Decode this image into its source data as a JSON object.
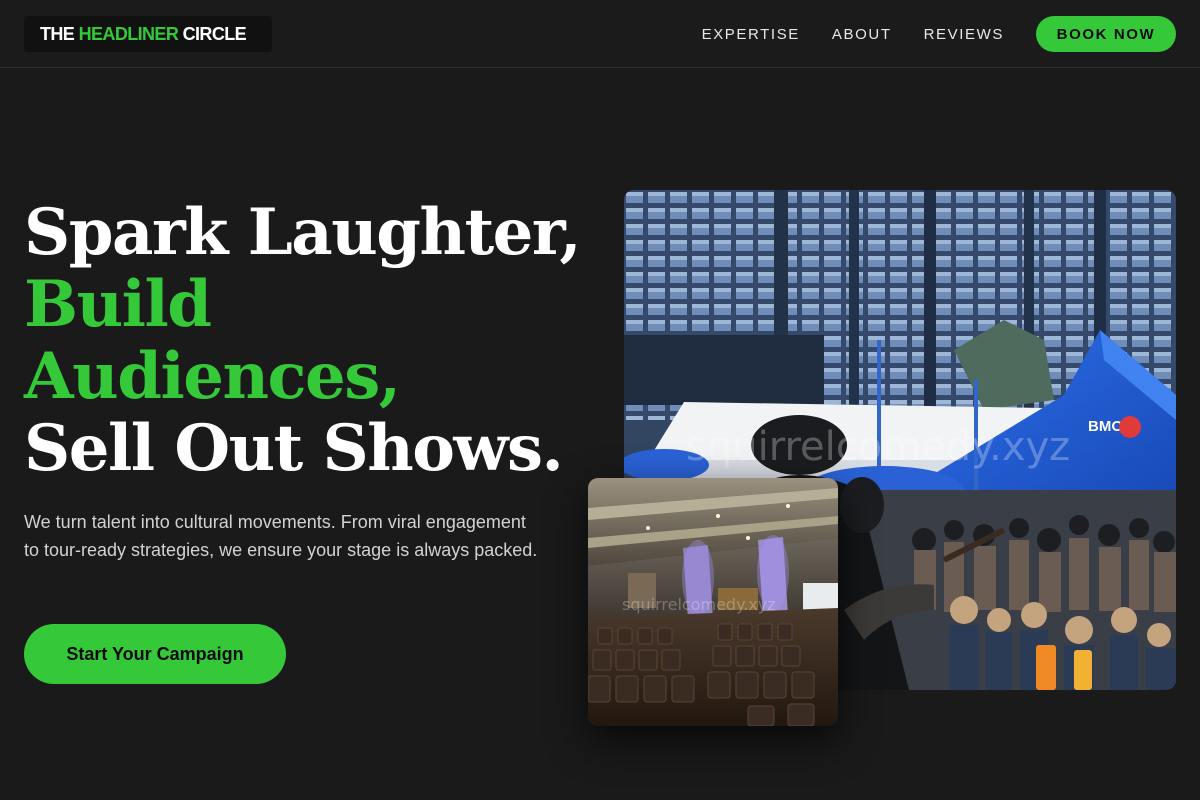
{
  "header": {
    "logo": {
      "prefix": "THE ",
      "accent": "HEADLINER",
      "suffix": " CIRCLE"
    },
    "nav": [
      {
        "label": "EXPERTISE"
      },
      {
        "label": "ABOUT"
      },
      {
        "label": "REVIEWS"
      }
    ],
    "book_label": "BOOK NOW"
  },
  "hero": {
    "title_lines": [
      "Spark Laughter,",
      "Build",
      "Audiences,",
      "Sell Out Shows."
    ],
    "description": "We turn talent into cultural movements. From viral engagement to tour-ready strategies, we ensure your stage is always packed.",
    "cta_label": "Start Your Campaign"
  },
  "images": {
    "main_watermark": "squirrelcomedy.xyz",
    "main_tent_text": "BMO",
    "small_watermark": "squirrelcomedy.xyz"
  },
  "colors": {
    "accent": "#35c93a",
    "background": "#1a1a1a",
    "text": "#ffffff"
  }
}
